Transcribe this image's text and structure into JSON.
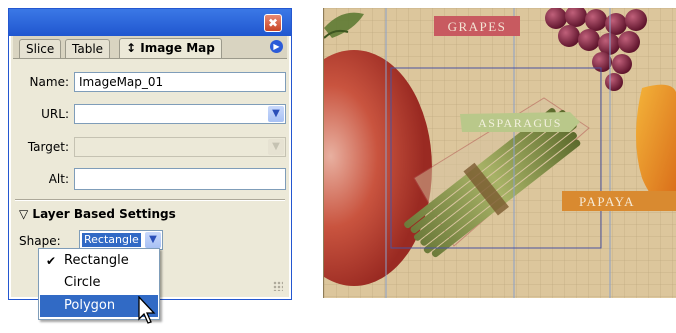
{
  "palette": {
    "tabs": [
      {
        "label": "Slice"
      },
      {
        "label": "Table"
      },
      {
        "label": "↕ Image Map",
        "active": true
      }
    ],
    "close_symbol": "✖",
    "menu_icon": "tab-menu-icon",
    "fields": {
      "name_label": "Name:",
      "name_value": "ImageMap_01",
      "url_label": "URL:",
      "url_value": "",
      "target_label": "Target:",
      "target_value": "",
      "alt_label": "Alt:",
      "alt_value": ""
    },
    "layer_section": {
      "title": "Layer Based Settings",
      "shape_label": "Shape:",
      "shape_value": "Rectangle"
    },
    "dropdown": {
      "options": [
        {
          "label": "Rectangle",
          "checked": true
        },
        {
          "label": "Circle"
        },
        {
          "label": "Polygon",
          "highlighted": true
        }
      ]
    }
  },
  "artwork": {
    "labels": {
      "grapes": "GRAPES",
      "asparagus": "ASPARAGUS",
      "papaya": "PAPAYA"
    },
    "colors": {
      "background": "#dcc69c",
      "grid": "#b49e76",
      "guide": "#8aa0c8",
      "selection": "#4a52a0",
      "grapes_label_bg": "#c85a60",
      "papaya_label_bg": "#d98a30",
      "asparagus_label_bg": "#b9c88a"
    }
  }
}
